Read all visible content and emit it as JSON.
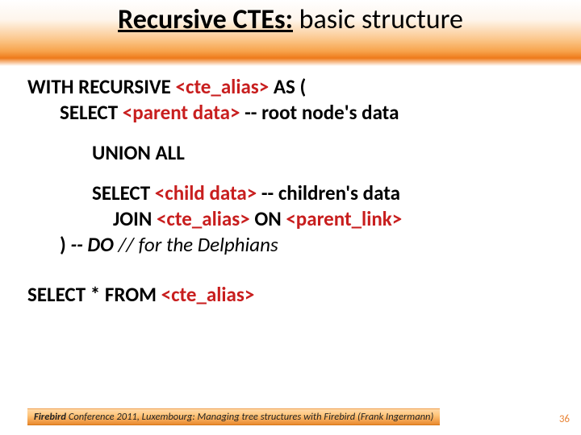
{
  "title": {
    "underlined": "Recursive CTEs:",
    "rest": " basic structure"
  },
  "code": {
    "l1a": "WITH RECURSIVE ",
    "l1b": "<cte_alias>",
    "l1c": " AS (",
    "l2a": "SELECT ",
    "l2b": "<parent data>",
    "l2c": " -- root node's data",
    "l3": "UNION ALL",
    "l4a": "SELECT ",
    "l4b": "<child data>",
    "l4c": " -- children's data",
    "l5a": "JOIN ",
    "l5b": "<cte_alias>",
    "l5c": " ON ",
    "l5d": "<parent_link>",
    "l6a": ") ",
    "l6b": " -- DO",
    "l6c": "    // for the Delphians",
    "l7a": "SELECT * FROM ",
    "l7b": "<cte_alias>"
  },
  "footer": {
    "brand": "Firebird",
    "rest": " Conference 2011, Luxembourg:  Managing tree structures with Firebird  (Frank Ingermann)"
  },
  "page": "36"
}
